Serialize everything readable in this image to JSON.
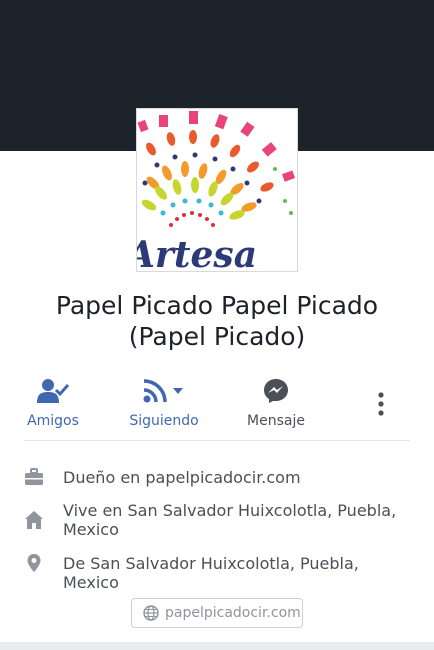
{
  "profile": {
    "name": "Papel Picado Papel Picado (Papel Picado)",
    "avatar_text": "Artesa"
  },
  "actions": [
    {
      "label": "Amigos",
      "icon": "friend-check-icon"
    },
    {
      "label": "Siguiendo",
      "icon": "rss-follow-icon"
    },
    {
      "label": "Mensaje",
      "icon": "messenger-icon"
    },
    {
      "label": "",
      "icon": "more-vertical-icon"
    }
  ],
  "about": [
    {
      "icon": "briefcase-icon",
      "text": "Dueño en papelpicadocir.com"
    },
    {
      "icon": "home-icon",
      "text": "Vive en San Salvador Huixcolotla, Puebla, Mexico"
    },
    {
      "icon": "location-pin-icon",
      "text": "De San Salvador Huixcolotla, Puebla, Mexico"
    }
  ],
  "website": "papelpicadocir.com",
  "colors": {
    "cover": "#1d232b",
    "accent": "#4267b2",
    "text": "#1d2129",
    "muted": "#4b4f56"
  }
}
